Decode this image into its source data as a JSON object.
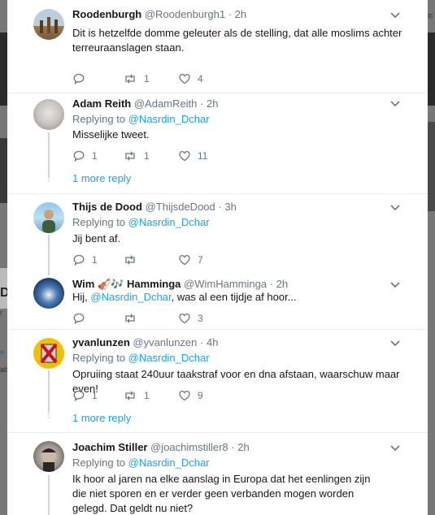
{
  "tweets": [
    {
      "name": "Roodenburgh",
      "handle": "@Roodenburgh1",
      "time": "2h",
      "text": "Dit is hetzelfde domme geleuter als de stelling, dat alle moslims achter terreuraanslagen staan.",
      "replies": "",
      "retweets": "1",
      "likes": "4"
    },
    {
      "name": "Adam Reith",
      "handle": "@AdamReith",
      "time": "2h",
      "replying_label": "Replying to",
      "replying_to": "@Nasrdin_Dchar",
      "text": "Misselijke tweet.",
      "replies": "1",
      "retweets": "1",
      "likes": "11",
      "more_replies": "1 more reply"
    },
    {
      "name": "Thijs de Dood",
      "handle": "@ThijsdeDood",
      "time": "3h",
      "replying_label": "Replying to",
      "replying_to": "@Nasrdin_Dchar",
      "text": "Jij bent af.",
      "replies": "1",
      "retweets": "",
      "likes": "7"
    },
    {
      "name_pre": "Wim",
      "name_emoji": "🎻🎶",
      "name_post": "Hamminga",
      "handle": "@WimHamminga",
      "time": "2h",
      "text_pre": "Hij,",
      "text_mention": "@Nasrdin_Dchar",
      "text_post": ", was al een tijdje af hoor...",
      "replies": "",
      "retweets": "",
      "likes": "3"
    },
    {
      "name": "yvanlunzen",
      "handle": "@yvanlunzen",
      "time": "4h",
      "replying_label": "Replying to",
      "replying_to": "@Nasrdin_Dchar",
      "text": "Opruiing staat 240uur taakstraf voor en dna afstaan, waarschuw maar even!",
      "replies": "1",
      "retweets": "1",
      "likes": "9",
      "more_replies": "1 more reply"
    },
    {
      "name": "Joachim Stiller",
      "handle": "@joachimstiller8",
      "time": "2h",
      "replying_label": "Replying to",
      "replying_to": "@Nasrdin_Dchar",
      "text": "Ik hoor al jaren na elke aanslag in Europa dat het eenlingen zijn die niet sporen en er verder geen verbanden mogen worden gelegd. Dat geldt nu niet?"
    }
  ],
  "background": {
    "left_letters": [
      "De",
      "r",
      "a",
      "ab"
    ],
    "right_letters": [
      "ic"
    ]
  },
  "colors": {
    "accent": "#1da1f2",
    "secondary_text": "#657786",
    "thread_line": "#ccd6dd",
    "separator": "#e6ecf0"
  }
}
